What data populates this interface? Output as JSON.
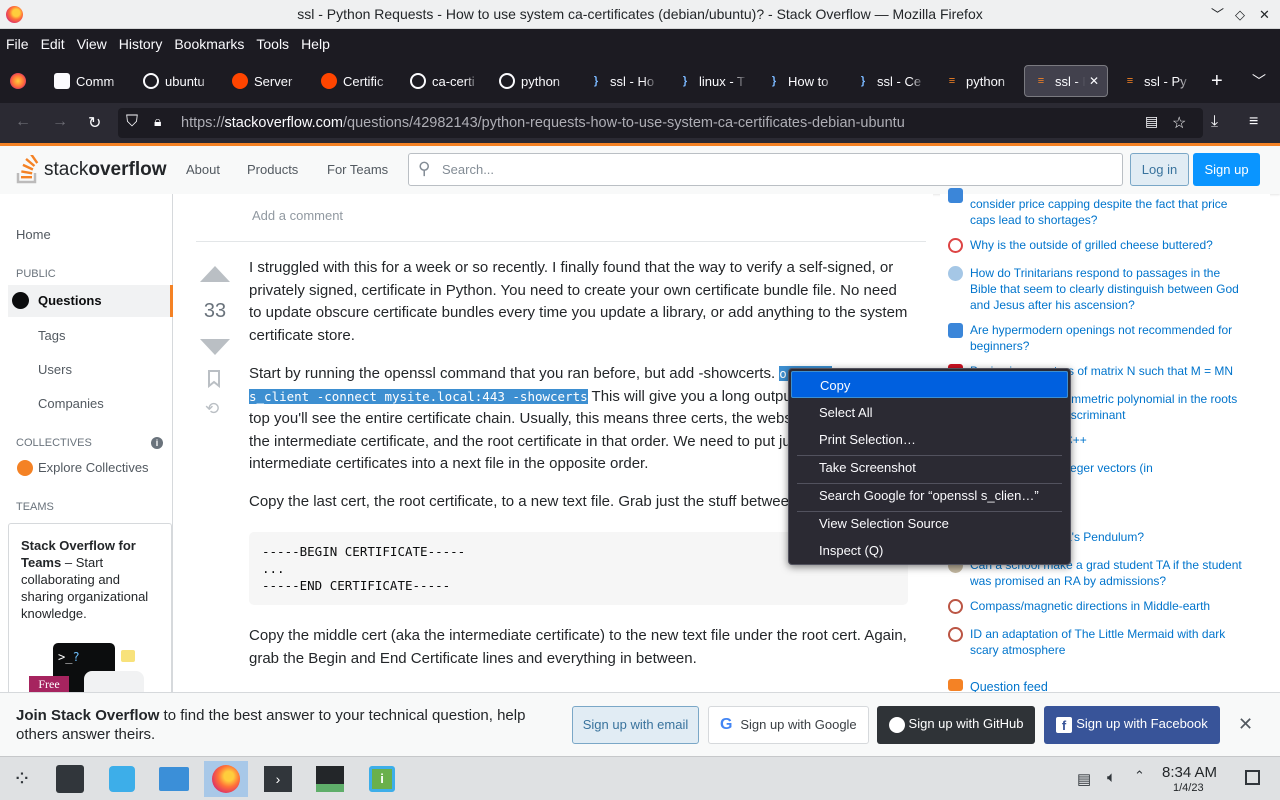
{
  "window": {
    "title": "ssl - Python Requests - How to use system ca-certificates (debian/ubuntu)? - Stack Overflow — Mozilla Firefox"
  },
  "menu": [
    "File",
    "Edit",
    "View",
    "History",
    "Bookmarks",
    "Tools",
    "Help"
  ],
  "tabs": [
    {
      "label": "Comm",
      "icon": "page-icon"
    },
    {
      "label": "ubuntu",
      "icon": "google-icon"
    },
    {
      "label": "Server",
      "icon": "reddit-icon"
    },
    {
      "label": "Certific",
      "icon": "reddit-icon"
    },
    {
      "label": "ca-certi",
      "icon": "google-icon"
    },
    {
      "label": "python",
      "icon": "google-icon"
    },
    {
      "label": "ssl - Ho",
      "icon": "unix-se-icon"
    },
    {
      "label": "linux - T",
      "icon": "unix-se-icon"
    },
    {
      "label": "How to",
      "icon": "unix-se-icon"
    },
    {
      "label": "ssl - Ce",
      "icon": "unix-se-icon"
    },
    {
      "label": "python",
      "icon": "stackoverflow-icon"
    },
    {
      "label": "ssl - P",
      "icon": "stackoverflow-icon",
      "active": true
    },
    {
      "label": "ssl - Py",
      "icon": "stackoverflow-icon"
    }
  ],
  "url": {
    "prefix": "https://",
    "host": "stackoverflow.com",
    "path": "/questions/42982143/python-requests-how-to-use-system-ca-certificates-debian-ubuntu"
  },
  "so_header": {
    "logo_a": "stack",
    "logo_b": "overflow",
    "nav": [
      "About",
      "Products",
      "For Teams"
    ],
    "search_placeholder": "Search...",
    "login": "Log in",
    "signup": "Sign up"
  },
  "leftnav": {
    "home": "Home",
    "public": "PUBLIC",
    "questions": "Questions",
    "tags": "Tags",
    "users": "Users",
    "companies": "Companies",
    "collectives": "COLLECTIVES",
    "explore": "Explore Collectives",
    "teams": "TEAMS",
    "teams_title": "Stack Overflow for Teams",
    "teams_desc": " – Start collaborating and sharing organizational knowledge.",
    "free": "Free"
  },
  "answer": {
    "add_comment": "Add a comment",
    "votes": "33",
    "p1": "I struggled with this for a week or so recently. I finally found that the way to verify a self-signed, or privately signed, certificate in Python. You need to create your own certificate bundle file. No need to update obscure certificate bundles every time you update a library, or add anything to the system certificate store.",
    "p2_start": "Start by running the openssl command that you ran before, but add -showcerts. ",
    "p2_code1": "openssl",
    "p2_code2": "s_client -connect mysite.local:443 -showcerts",
    "p2_rest1": " This will give you a long output. At the",
    "p2_line3": "top you'll see the entire certificate chain. Usually, this means three certs, the website's certificate,",
    "p2_line4": "the intermediate certificate, and the root certificate in that order. We need to put just the root and",
    "p2_line5": "intermediate certificates into a next file in the opposite order.",
    "p3": "Copy the last cert, the root certificate, to a new text file. Grab just the stuff between and including:",
    "code": "-----BEGIN CERTIFICATE-----\n...\n-----END CERTIFICATE-----",
    "p4": "Copy the middle cert (aka the intermediate certificate) to the new text file under the root cert. Again, grab the Begin and End Certificate lines and everything in between."
  },
  "hot_questions": [
    "consider price capping despite the fact that price caps lead to shortages?",
    "Why is the outside of grilled cheese buttered?",
    "How do Trinitarians respond to passages in the Bible that seem to clearly distinguish between God and Jesus after his ascension?",
    "Are hypermodern openings not recommended for beginners?",
    "Basis eigen vectors of matrix N such that M = MNM",
    "Coefficients of a symmetric polynomial in the roots expressed in the discriminant",
    "Smart pointers in C++",
    "Inner product of integer vectors (in",
    "Galitzin's... Kapitza's Pendulum?",
    "Can a school make a grad student TA if the student was promised an RA by admissions?",
    "Compass/magnetic directions in Middle-earth",
    "ID an adaptation of The Little Mermaid with dark scary atmosphere"
  ],
  "question_feed": "Question feed",
  "context_menu": [
    "Copy",
    "Select All",
    "Print Selection…",
    "Take Screenshot",
    "Search Google for “openssl s_clien…”",
    "View Selection Source",
    "Inspect (Q)"
  ],
  "banner": {
    "bold": "Join Stack Overflow",
    "text": " to find the best answer to your technical question, help others answer theirs.",
    "email": "Sign up with email",
    "google": "Sign up with Google",
    "github": "Sign up with GitHub",
    "facebook": "Sign up with Facebook"
  },
  "taskbar": {
    "time": "8:34 AM",
    "date": "1/4/23"
  },
  "colors": {
    "so_orange": "#f48225",
    "so_blue": "#0a95ff",
    "link": "#0074cc",
    "ff_dark": "#1c1b22"
  }
}
